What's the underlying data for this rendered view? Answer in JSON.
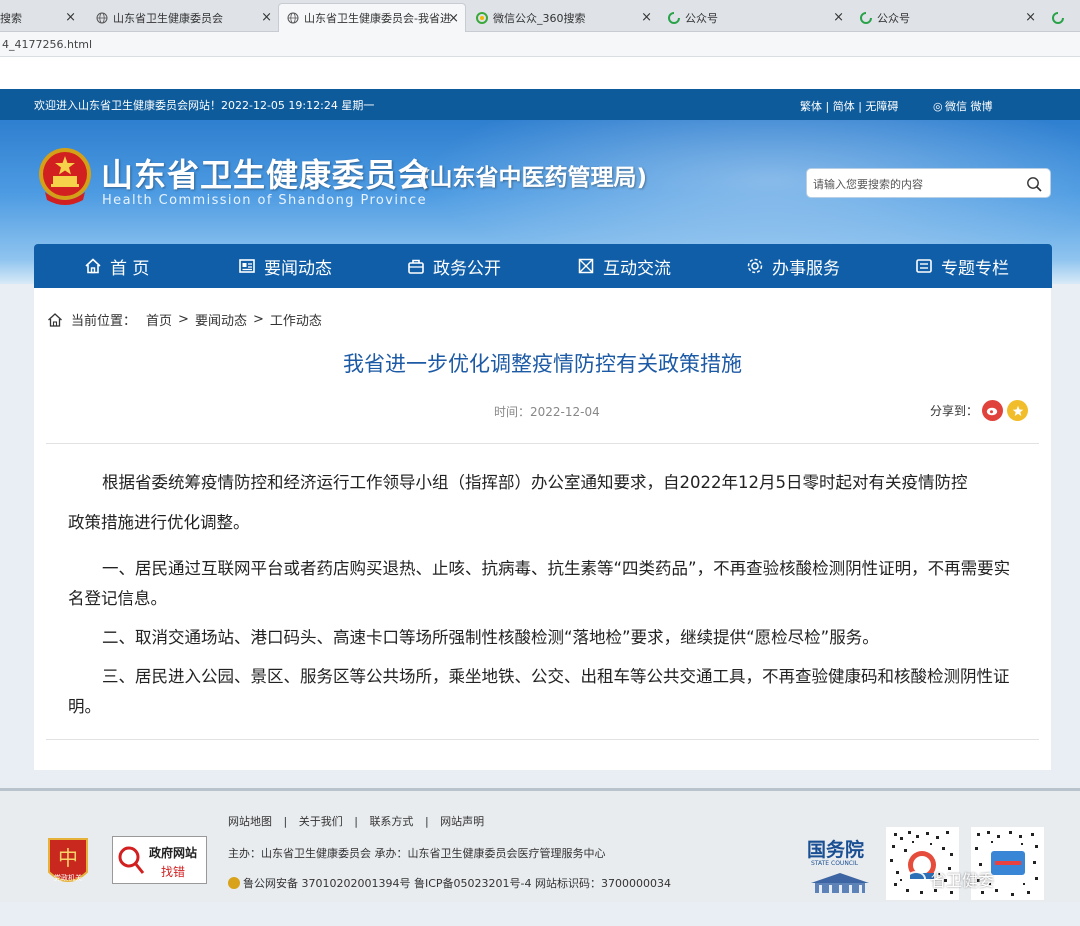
{
  "browser": {
    "tabs": [
      {
        "label": "搜索",
        "icon": "none"
      },
      {
        "label": "山东省卫生健康委员会",
        "icon": "globe-icon"
      },
      {
        "label": "山东省卫生健康委员会-我省进",
        "icon": "globe-icon"
      },
      {
        "label": "微信公众_360搜索",
        "icon": "search-360-icon"
      },
      {
        "label": "公众号",
        "icon": "sogou-icon"
      },
      {
        "label": "公众号",
        "icon": "sogou-icon"
      },
      {
        "label": "",
        "icon": "sogou-icon"
      }
    ],
    "close_glyph": "×",
    "address": "4_4177256.html"
  },
  "topbar": {
    "welcome": "欢迎进入山东省卫生健康委员会网站！2022-12-05 19:12:24 星期一",
    "lang_links": "繁体 | 简体 | 无障碍",
    "social": "微信  微博"
  },
  "header": {
    "title": "山东省卫生健康委员会",
    "subtitle": "(山东省中医药管理局)",
    "english": "Health Commission of Shandong Province",
    "search_placeholder": "请输入您要搜索的内容"
  },
  "nav": [
    {
      "label": "首 页",
      "icon": "home-icon"
    },
    {
      "label": "要闻动态",
      "icon": "news-icon"
    },
    {
      "label": "政务公开",
      "icon": "building-icon"
    },
    {
      "label": "互动交流",
      "icon": "exchange-icon"
    },
    {
      "label": "办事服务",
      "icon": "service-icon"
    },
    {
      "label": "专题专栏",
      "icon": "column-icon"
    }
  ],
  "breadcrumb": {
    "label": "当前位置：",
    "items": [
      "首页",
      "要闻动态",
      "工作动态"
    ],
    "sep": ">"
  },
  "article": {
    "title": "我省进一步优化调整疫情防控有关政策措施",
    "time": "时间：2022-12-04",
    "share_label": "分享到：",
    "paragraphs": [
      "根据省委统筹疫情防控和经济运行工作领导小组（指挥部）办公室通知要求，自2022年12月5日零时起对有关疫情防控",
      "政策措施进行优化调整。",
      "一、居民通过互联网平台或者药店购买退热、止咳、抗病毒、抗生素等“四类药品”，不再查验核酸检测阴性证明，不再需要实名登记信息。",
      "二、取消交通场站、港口码头、高速卡口等场所强制性核酸检测“落地检”要求，继续提供“愿检尽检”服务。",
      "三、居民进入公园、景区、服务区等公共场所，乘坐地铁、公交、出租车等公共交通工具，不再查验健康码和核酸检测阴性证明。"
    ]
  },
  "footer": {
    "links": [
      "网站地图",
      "关于我们",
      "联系方式",
      "网站声明"
    ],
    "sponsor": "主办：山东省卫生健康委员会   承办：山东省卫生健康委员会医疗管理服务中心",
    "record": "鲁公网安备 37010202001394号   鲁ICP备05023201号-4   网站标识码：3700000034",
    "badge_party": "党政机关",
    "badge_gov_top": "政府网站",
    "badge_gov_bottom": "找错",
    "state_council": "国务院",
    "state_council_en": "STATE COUNCIL",
    "watermark": "省卫健委"
  }
}
